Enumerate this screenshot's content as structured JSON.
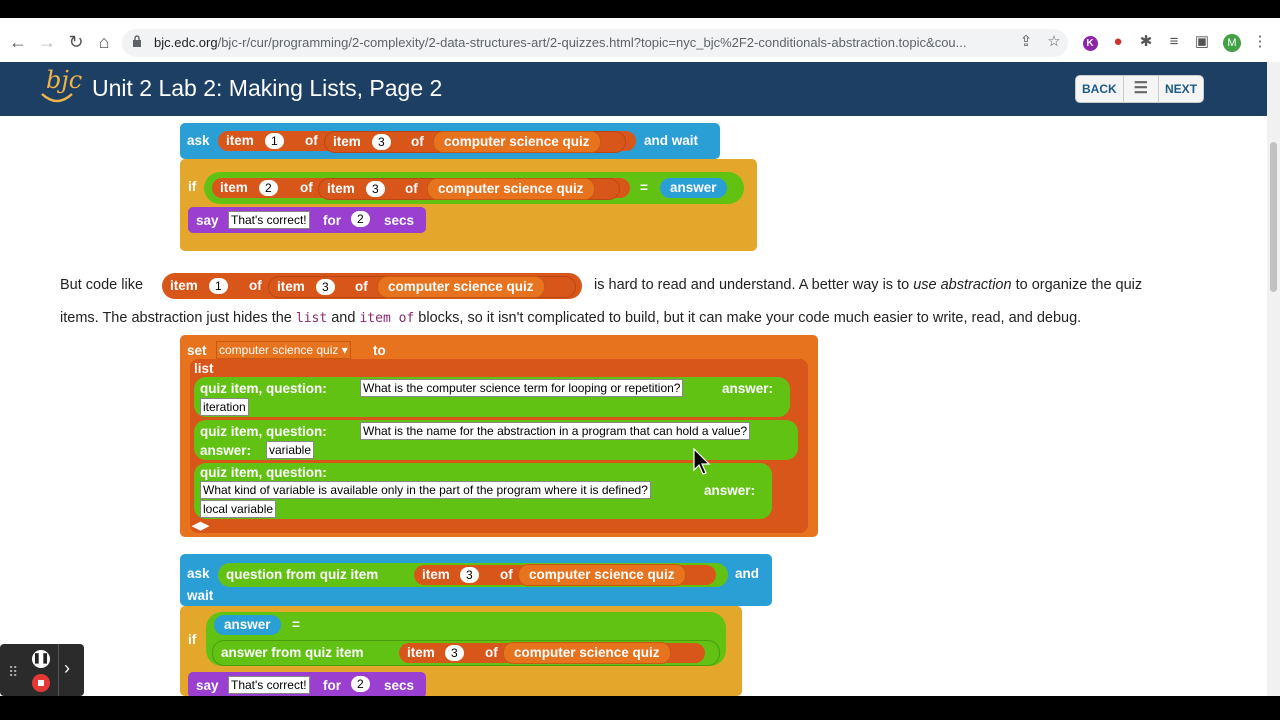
{
  "browser": {
    "url_domain": "bjc.edc.org",
    "url_path": "/bjc-r/cur/programming/2-complexity/2-data-structures-art/2-quizzes.html?topic=nyc_bjc%2F2-conditionals-abstraction.topic&cou...",
    "profile_initial": "M"
  },
  "site": {
    "logo_text": "bjc",
    "title": "Unit 2 Lab 2: Making Lists, Page 2",
    "nav": {
      "back": "BACK",
      "next": "NEXT"
    }
  },
  "block1": {
    "ask": "ask",
    "item": "item",
    "of": "of",
    "and_wait": "and wait",
    "n1": "1",
    "n3": "3",
    "var": "computer science quiz",
    "if": "if",
    "n2": "2",
    "eq": "=",
    "answer": "answer",
    "say": "say",
    "say_text": "That's correct!",
    "for": "for",
    "secs_n": "2",
    "secs": "secs"
  },
  "paragraph": {
    "t1": "But code like",
    "t2": "is hard to read and understand. A better way is to",
    "em": "use abstraction",
    "t3": "to organize the quiz",
    "t4": "items. The abstraction just hides the",
    "code1": "list",
    "t5": "and",
    "code2": "item of",
    "t6": "blocks, so it isn't complicated to build, but it can make your code much easier to write, read, and debug."
  },
  "block2": {
    "set": "set",
    "var": "computer science quiz",
    "to": "to",
    "list": "list",
    "qi": "quiz item, question:",
    "ans": "answer:",
    "q1": "What is the computer science term for looping or repetition?",
    "a1": "iteration",
    "q2": "What is the name for the abstraction in a program that can hold a value?",
    "a2": "variable",
    "q3": "What kind of variable is available only in the part of the program where it is defined?",
    "a3": "local variable"
  },
  "block3": {
    "ask": "ask",
    "question_from": "question from quiz item",
    "item": "item",
    "n3": "3",
    "of": "of",
    "var": "computer science quiz",
    "and": "and",
    "wait": "wait",
    "if": "if",
    "answer": "answer",
    "eq": "=",
    "answer_from": "answer from quiz item",
    "say": "say",
    "say_text": "That's correct!",
    "for": "for",
    "secs_n": "2",
    "secs": "secs"
  }
}
